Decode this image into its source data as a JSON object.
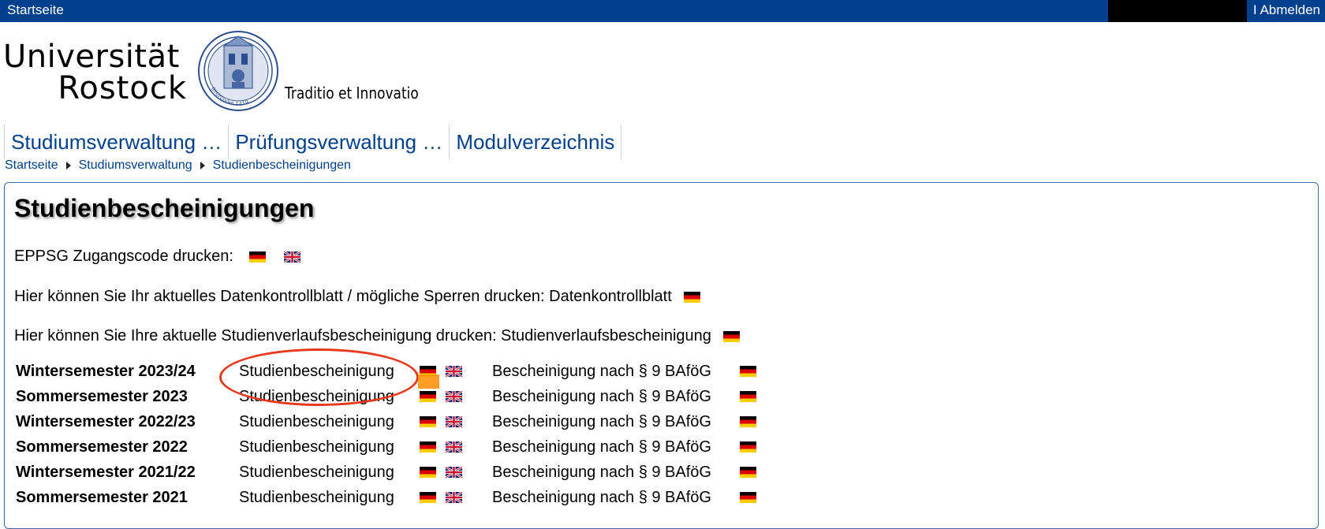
{
  "topbar": {
    "home_label": "Startseite",
    "separator": "I",
    "logout_label": "Abmelden"
  },
  "logo": {
    "line1": "Universität",
    "line2": "Rostock",
    "seal_icon": "university-seal-icon",
    "seal_text": "gegründet 1419",
    "slogan": "Traditio et Innovatio"
  },
  "nav": {
    "tabs": [
      {
        "label": "Studiumsverwaltung …"
      },
      {
        "label": "Prüfungsverwaltung …"
      },
      {
        "label": "Modulverzeichnis"
      }
    ]
  },
  "breadcrumb": [
    "Startseite",
    "Studiumsverwaltung",
    "Studienbescheinigungen"
  ],
  "main": {
    "title": "Studienbescheinigungen",
    "eppsg_label": "EPPSG Zugangscode drucken:",
    "datenkontroll_text": "Hier können Sie Ihr aktuelles Datenkontrollblatt / mögliche Sperren drucken: Datenkontrollblatt",
    "studienverlauf_text": "Hier können Sie Ihre aktuelle Studienverlaufsbescheinigung drucken: Studienverlaufsbescheinigung",
    "semesters": [
      {
        "name": "Wintersemester 2023/24",
        "cert": "Studienbescheinigung",
        "bafoeg": "Bescheinigung nach § 9 BAföG"
      },
      {
        "name": "Sommersemester 2023",
        "cert": "Studienbescheinigung",
        "bafoeg": "Bescheinigung nach § 9 BAföG"
      },
      {
        "name": "Wintersemester 2022/23",
        "cert": "Studienbescheinigung",
        "bafoeg": "Bescheinigung nach § 9 BAföG"
      },
      {
        "name": "Sommersemester 2022",
        "cert": "Studienbescheinigung",
        "bafoeg": "Bescheinigung nach § 9 BAföG"
      },
      {
        "name": "Wintersemester 2021/22",
        "cert": "Studienbescheinigung",
        "bafoeg": "Bescheinigung nach § 9 BAföG"
      },
      {
        "name": "Sommersemester 2021",
        "cert": "Studienbescheinigung",
        "bafoeg": "Bescheinigung nach § 9 BAföG"
      }
    ]
  },
  "icons": {
    "german_flag": "german-flag-icon",
    "uk_flag": "uk-flag-icon",
    "breadcrumb_separator": "triangle-right-icon"
  },
  "colors": {
    "brand_blue": "#00408c",
    "annotation_red": "#e6391c",
    "highlight_orange": "#ff8c00"
  }
}
